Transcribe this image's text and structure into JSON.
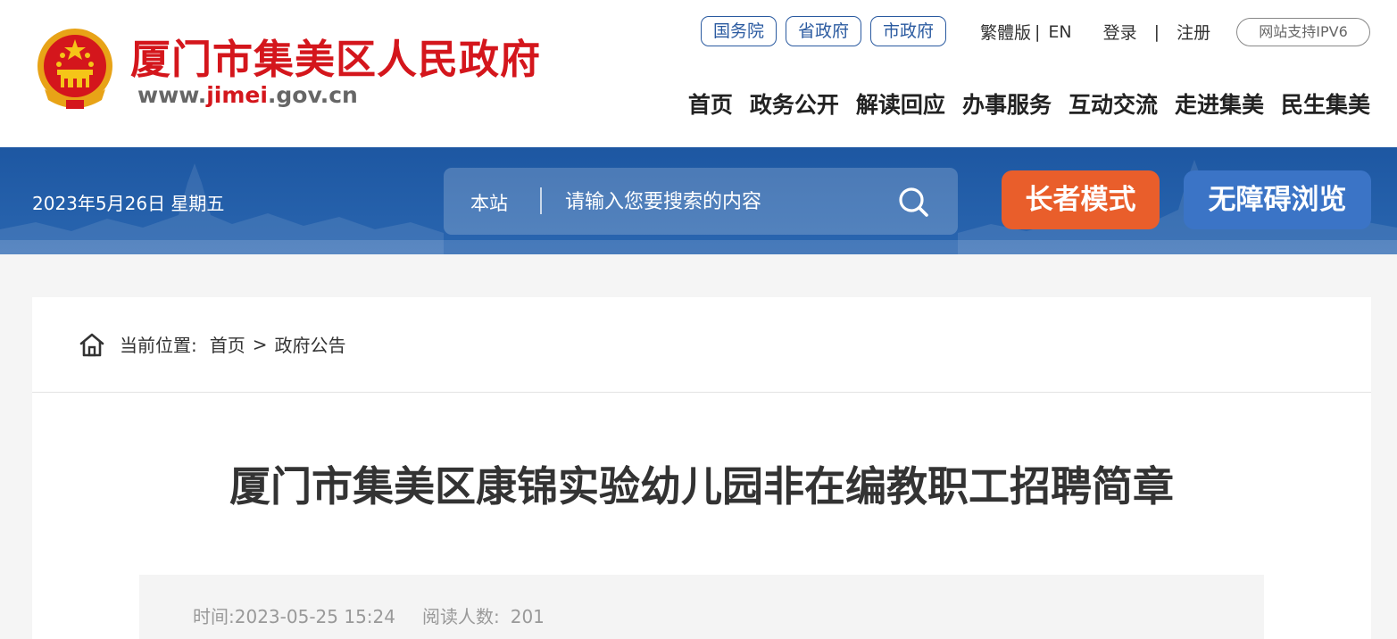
{
  "header": {
    "site_title": "厦门市集美区人民政府",
    "url_prefix": "www.",
    "url_highlight": "jimei",
    "url_suffix": ".gov.cn",
    "gov_links": [
      "国务院",
      "省政府",
      "市政府"
    ],
    "util": {
      "traditional": "繁體版",
      "sep": "|",
      "english": "EN",
      "login": "登录",
      "register": "注册"
    },
    "ipv6": "网站支持IPV6",
    "nav": [
      "首页",
      "政务公开",
      "解读回应",
      "办事服务",
      "互动交流",
      "走进集美",
      "民生集美"
    ]
  },
  "banner": {
    "date": "2023年5月26日 星期五",
    "search_scope": "本站",
    "search_placeholder": "请输入您要搜索的内容",
    "elder_mode": "长者模式",
    "accessible": "无障碍浏览"
  },
  "breadcrumb": {
    "label": "当前位置:",
    "home": "首页",
    "arrow": ">",
    "current": "政府公告"
  },
  "article": {
    "title": "厦门市集美区康锦实验幼儿园非在编教职工招聘简章",
    "time_label": "时间:",
    "time": "2023-05-25 15:24",
    "reads_label": "阅读人数:",
    "reads": "201"
  },
  "colors": {
    "brand_red": "#d4161c",
    "banner_blue": "#1d57a2",
    "elder_orange": "#e95e2b",
    "access_blue": "#3b74c6"
  }
}
